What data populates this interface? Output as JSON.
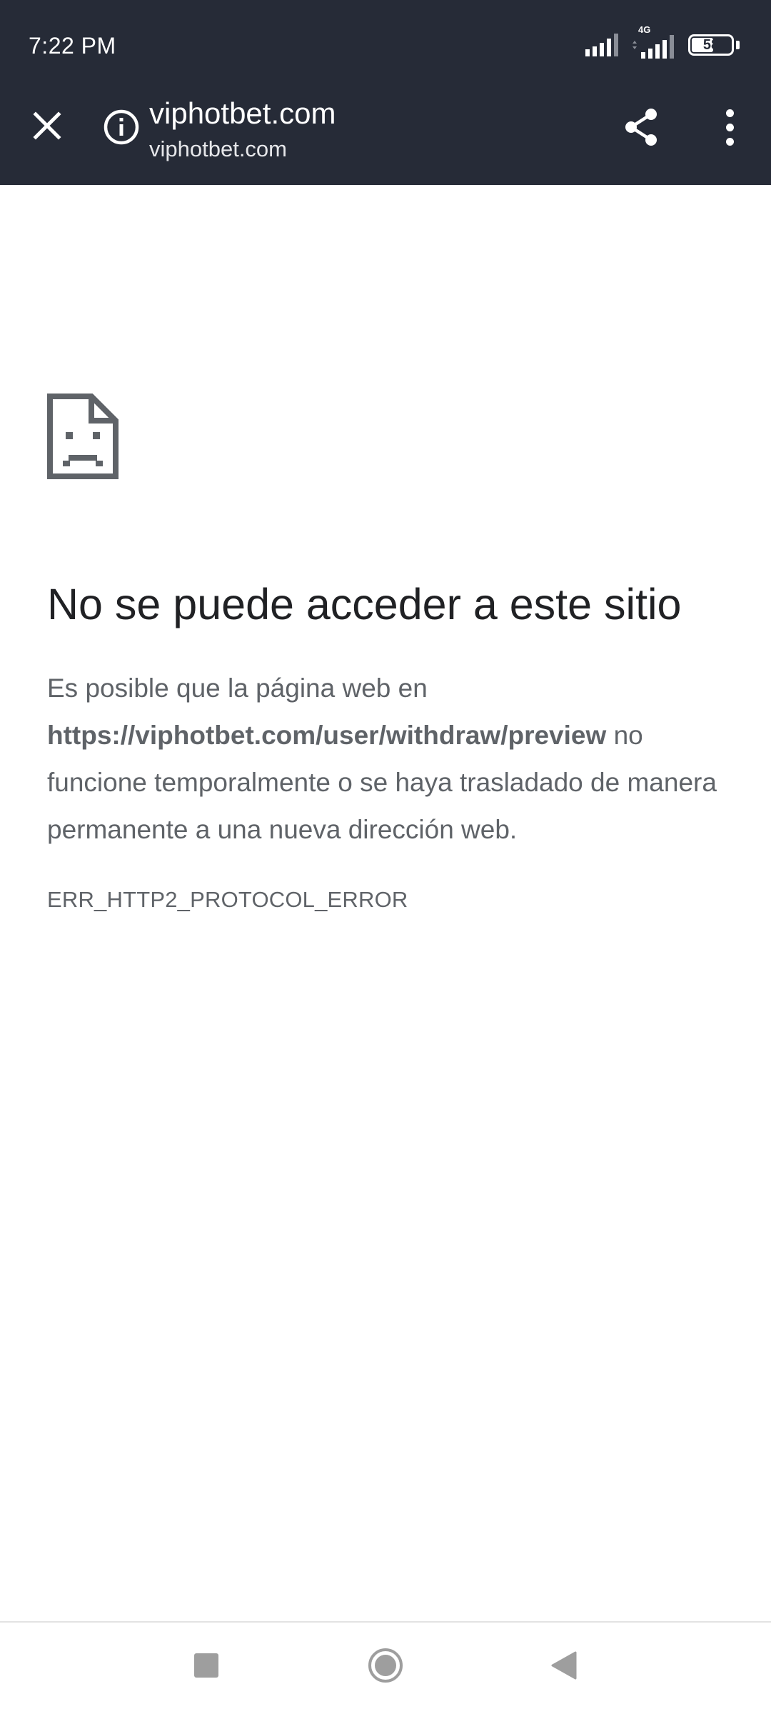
{
  "status_bar": {
    "time": "7:22 PM",
    "network_type": "4G",
    "battery_level": "58",
    "battery_percent": 58
  },
  "toolbar": {
    "title": "viphotbet.com",
    "url": "viphotbet.com",
    "icons": [
      "close-icon",
      "info-icon",
      "share-icon",
      "more-vert-icon"
    ]
  },
  "error_page": {
    "heading": "No se puede acceder a este sitio",
    "body_prefix": "Es posible que la página web en",
    "body_url": "https://viphotbet.com/user/withdraw/preview",
    "body_suffix": "no funcione temporalmente o se haya trasladado de manera permanente a una nueva dirección web.",
    "error_code": "ERR_HTTP2_PROTOCOL_ERROR",
    "icon": "sad-page-icon"
  },
  "navigation_bar": {
    "icons": [
      "recents-icon",
      "home-icon",
      "back-icon"
    ]
  },
  "colors": {
    "toolbar_background": "#262b37",
    "heading_text": "#202124",
    "body_text": "#5f6368",
    "page_background": "#ffffff"
  }
}
